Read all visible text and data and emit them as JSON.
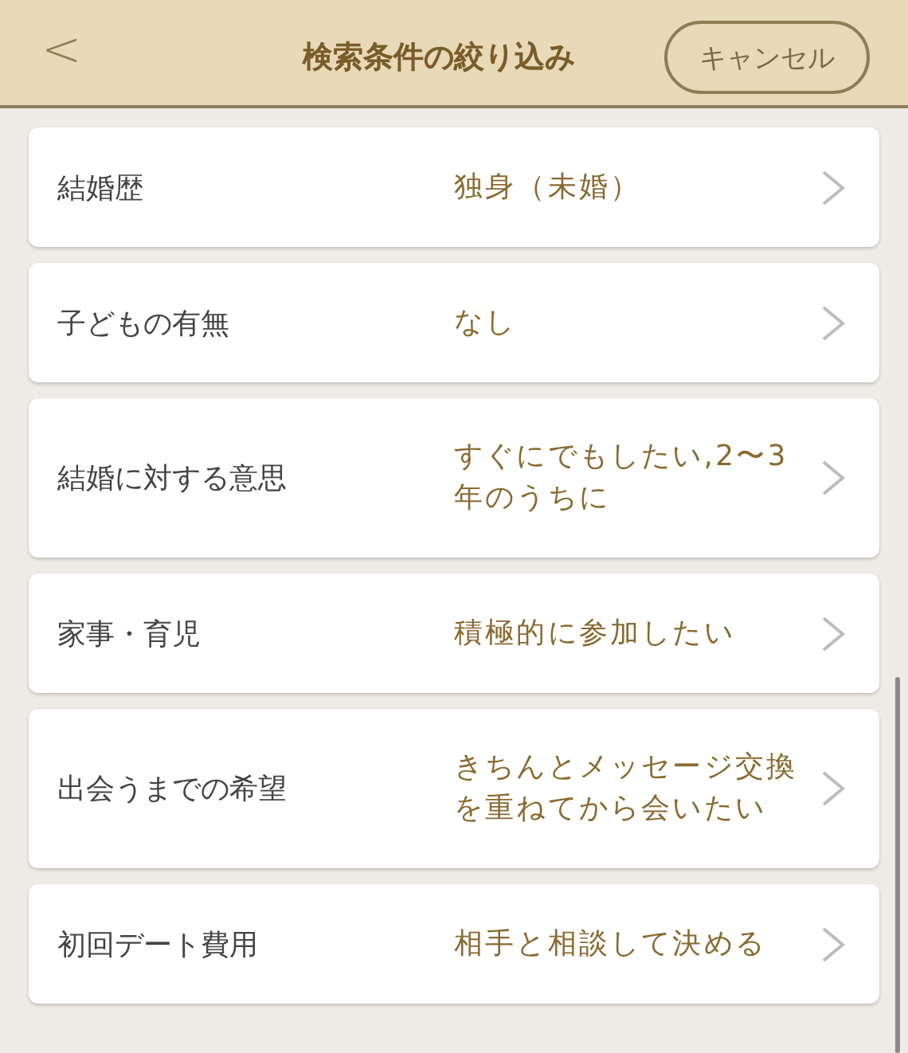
{
  "header": {
    "back": "<",
    "title": "検索条件の絞り込み",
    "cancel": "キャンセル"
  },
  "items": [
    {
      "label": "結婚歴",
      "value": "独身（未婚）"
    },
    {
      "label": "子どもの有無",
      "value": "なし"
    },
    {
      "label": "結婚に対する意思",
      "value": "すぐにでもしたい,2〜3年のうちに"
    },
    {
      "label": "家事・育児",
      "value": "積極的に参加したい"
    },
    {
      "label": "出会うまでの希望",
      "value": "きちんとメッセージ交換を重ねてから会いたい"
    },
    {
      "label": "初回デート費用",
      "value": "相手と相談して決める"
    }
  ]
}
